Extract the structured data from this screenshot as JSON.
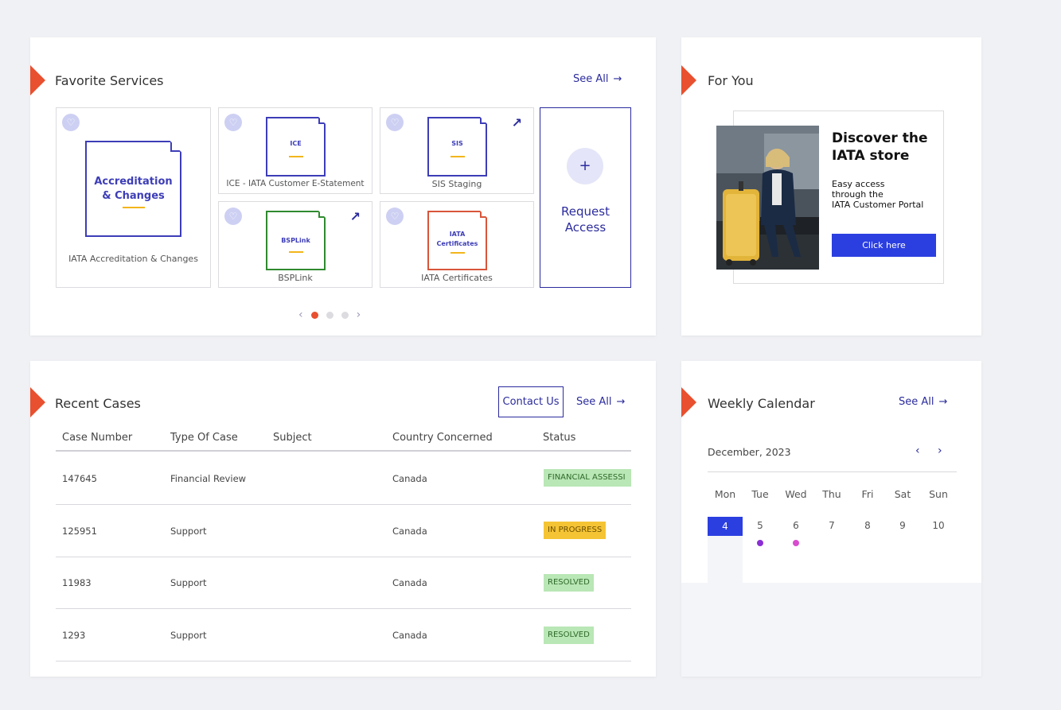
{
  "favorites": {
    "title": "Favorite Services",
    "see_all": "See All",
    "tiles": [
      {
        "doc_label_line1": "Accreditation",
        "doc_label_line2": "& Changes",
        "caption": "IATA Accreditation & Changes"
      },
      {
        "doc_label": "ICE",
        "caption": "ICE - IATA Customer E-Statement"
      },
      {
        "doc_label": "SIS",
        "caption": "SIS Staging"
      },
      {
        "doc_label": "BSPLink",
        "caption": "BSPLink"
      },
      {
        "doc_label_line1": "IATA",
        "doc_label_line2": "Certificates",
        "caption": "IATA Certificates"
      }
    ],
    "request": {
      "plus": "+",
      "label_line1": "Request",
      "label_line2": "Access"
    },
    "pager": {
      "pages": 3,
      "active": 1
    }
  },
  "for_you": {
    "title": "For You",
    "promo": {
      "title_line1": "Discover the",
      "title_line2": "IATA store",
      "text_line1": "Easy access",
      "text_line2": "through the",
      "text_line3": "IATA Customer Portal",
      "button": "Click here"
    }
  },
  "cases": {
    "title": "Recent Cases",
    "contact": "Contact Us",
    "see_all": "See All",
    "headers": {
      "case_number": "Case Number",
      "type": "Type Of Case",
      "subject": "Subject",
      "country": "Country Concerned",
      "status": "Status"
    },
    "rows": [
      {
        "case_number": "147645",
        "type": "Financial Review",
        "subject": "",
        "country": "Canada",
        "status": "FINANCIAL ASSESSI"
      },
      {
        "case_number": "125951",
        "type": "Support",
        "subject": "",
        "country": "Canada",
        "status": "IN PROGRESS"
      },
      {
        "case_number": "11983",
        "type": "Support",
        "subject": "",
        "country": "Canada",
        "status": "RESOLVED"
      },
      {
        "case_number": "1293",
        "type": "Support",
        "subject": "",
        "country": "Canada",
        "status": "RESOLVED"
      }
    ]
  },
  "calendar": {
    "title": "Weekly Calendar",
    "see_all": "See All",
    "month": "December, 2023",
    "days_of_week": [
      "Mon",
      "Tue",
      "Wed",
      "Thu",
      "Fri",
      "Sat",
      "Sun"
    ],
    "dates": [
      "4",
      "5",
      "6",
      "7",
      "8",
      "9",
      "10"
    ],
    "today_index": 0
  },
  "colors": {
    "accent": "#e8502f",
    "brand": "#2b2b9e",
    "button": "#2b3fe0",
    "resolved": "#b9e7b5",
    "in_progress": "#f5c434"
  }
}
